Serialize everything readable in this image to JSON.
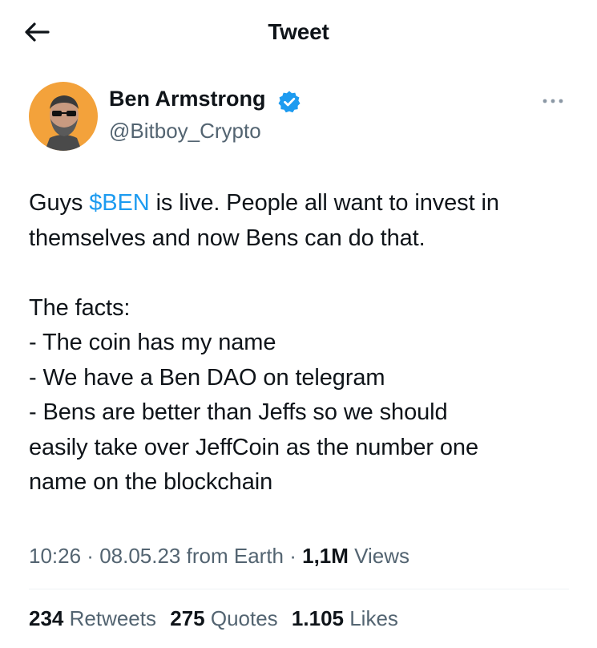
{
  "header": {
    "title": "Tweet",
    "back_icon": "arrow-left-icon"
  },
  "author": {
    "display_name": "Ben Armstrong",
    "handle": "@Bitboy_Crypto",
    "verified_icon": "verified-badge-icon",
    "verified_color": "#1d9bf0",
    "avatar_bg": "#f3a23b",
    "more_icon": "more-horizontal-icon"
  },
  "tweet": {
    "line1_before": "Guys ",
    "cashtag": "$BEN",
    "line1_after": " is live. People all want to invest in",
    "line2": "themselves and now Bens can do that.",
    "line3": "The facts:",
    "line4": "- The coin has my name",
    "line5": "- We have a Ben DAO on telegram",
    "line6": "- Bens are better than Jeffs so we should",
    "line7": "easily take over JeffCoin as the number one",
    "line8": "name on the blockchain"
  },
  "meta": {
    "time": "10:26",
    "sep1": " · ",
    "date": "08.05.23",
    "source": " from Earth",
    "sep2": " · ",
    "views_count": "1,1M",
    "views_label": " Views"
  },
  "stats": {
    "retweets_count": "234",
    "retweets_label": " Retweets",
    "quotes_count": "275",
    "quotes_label": " Quotes",
    "likes_count": "1.105",
    "likes_label": " Likes"
  },
  "colors": {
    "accent": "#1d9bf0",
    "text_primary": "#0f1419",
    "text_secondary": "#536471",
    "divider": "#eff3f4"
  }
}
